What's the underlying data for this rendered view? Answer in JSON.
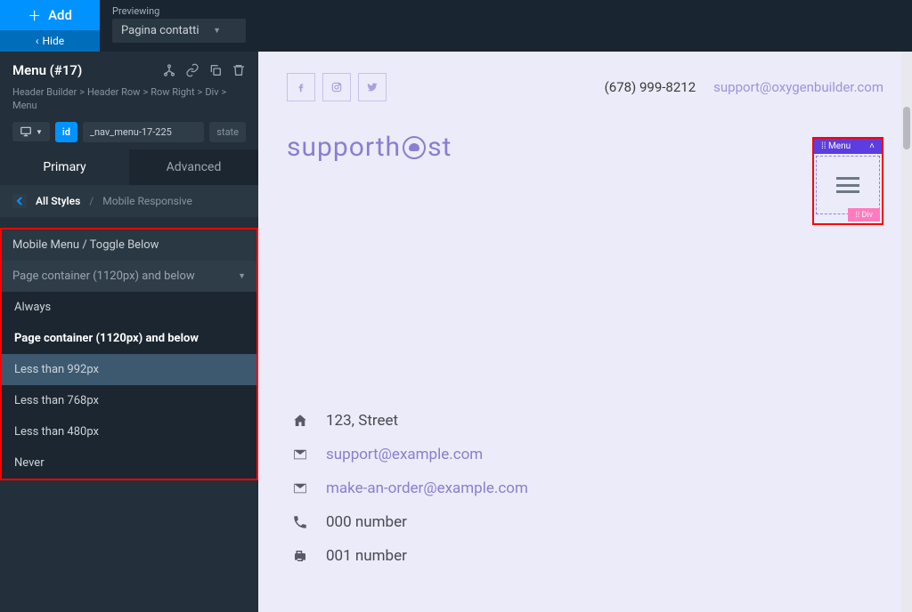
{
  "topbar": {
    "add": "Add",
    "hide": "Hide",
    "preview_label": "Previewing",
    "preview_value": "Pagina contatti"
  },
  "panel": {
    "title": "Menu (#17)",
    "breadcrumb": [
      "Header Builder",
      "Header Row",
      "Row Right",
      "Div",
      "Menu"
    ],
    "id_label": "id",
    "id_value": "_nav_menu-17-225",
    "state": "state"
  },
  "tabs": {
    "primary": "Primary",
    "advanced": "Advanced"
  },
  "sub_bc": {
    "root": "All Styles",
    "current": "Mobile Responsive"
  },
  "section": {
    "title": "Mobile Menu / Toggle Below",
    "current": "Page container (1120px) and below",
    "options": [
      {
        "label": "Always",
        "selected": false,
        "hover": false
      },
      {
        "label": "Page container (1120px) and below",
        "selected": true,
        "hover": false
      },
      {
        "label": "Less than 992px",
        "selected": false,
        "hover": true
      },
      {
        "label": "Less than 768px",
        "selected": false,
        "hover": false
      },
      {
        "label": "Less than 480px",
        "selected": false,
        "hover": false
      },
      {
        "label": "Never",
        "selected": false,
        "hover": false
      }
    ]
  },
  "canvas": {
    "phone": "(678) 999-8212",
    "support_email": "support@oxygenbuilder.com",
    "logo_a": "supporth",
    "logo_b": "st",
    "menu_tag": "Menu",
    "div_tag": "Div",
    "contacts": {
      "address": "123, Street",
      "email1": "support@example.com",
      "email2": "make-an-order@example.com",
      "phone1": "000 number",
      "phone2": "001 number"
    }
  }
}
